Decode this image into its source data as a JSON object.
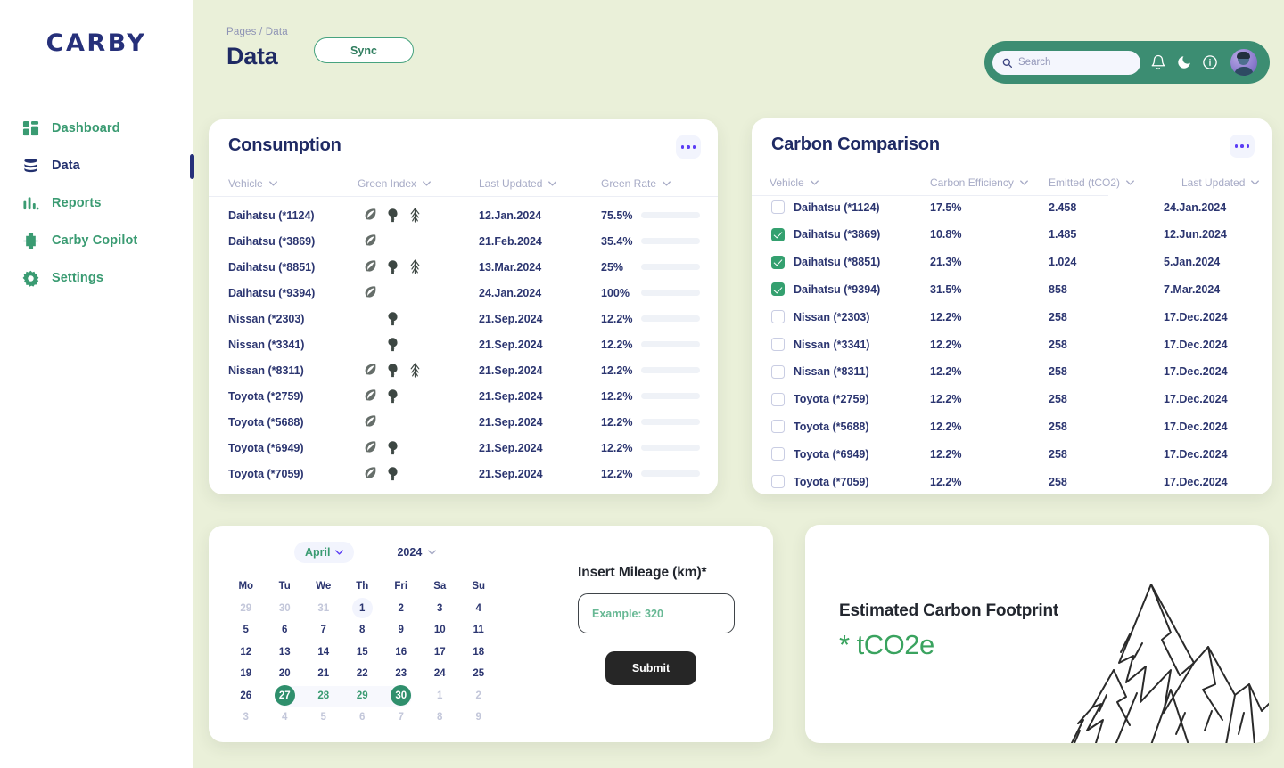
{
  "brand": {
    "logo": "CARBY"
  },
  "accent": {
    "green": "#3a9b72",
    "navy": "#22306e",
    "purple": "#5b3df5",
    "bar": "#2f8f6c",
    "page_bg": "#eaf0d9",
    "topbar": "#3c8d72"
  },
  "sidebar": {
    "items": [
      {
        "label": "Dashboard",
        "icon": "dashboard-icon",
        "active": false
      },
      {
        "label": "Data",
        "icon": "database-icon",
        "active": true
      },
      {
        "label": "Reports",
        "icon": "bar-chart-icon",
        "active": false
      },
      {
        "label": "Carby Copilot",
        "icon": "clover-icon",
        "active": false
      },
      {
        "label": "Settings",
        "icon": "gear-icon",
        "active": false
      }
    ]
  },
  "header": {
    "breadcrumb": "Pages / Data",
    "title": "Data",
    "sync_label": "Sync",
    "search_placeholder": "Search",
    "search_value": "",
    "icons": [
      "bell-icon",
      "moon-icon",
      "info-icon"
    ]
  },
  "consumption": {
    "title": "Consumption",
    "columns": [
      "Vehicle",
      "Green Index",
      "Last Updated",
      "Green Rate"
    ],
    "rows": [
      {
        "vehicle": "Daihatsu (*1124)",
        "index": [
          "leaf",
          "tree",
          "pine"
        ],
        "updated": "12.Jan.2024",
        "rate": "75.5%",
        "pct": 75.5
      },
      {
        "vehicle": "Daihatsu (*3869)",
        "index": [
          "leaf"
        ],
        "updated": "21.Feb.2024",
        "rate": "35.4%",
        "pct": 35.4
      },
      {
        "vehicle": "Daihatsu (*8851)",
        "index": [
          "leaf",
          "tree",
          "pine"
        ],
        "updated": "13.Mar.2024",
        "rate": "25%",
        "pct": 25
      },
      {
        "vehicle": "Daihatsu (*9394)",
        "index": [
          "leaf"
        ],
        "updated": "24.Jan.2024",
        "rate": "100%",
        "pct": 100
      },
      {
        "vehicle": "Nissan (*2303)",
        "index": [
          "tree"
        ],
        "updated": "21.Sep.2024",
        "rate": "12.2%",
        "pct": 12.2
      },
      {
        "vehicle": "Nissan (*3341)",
        "index": [
          "tree"
        ],
        "updated": "21.Sep.2024",
        "rate": "12.2%",
        "pct": 12.2
      },
      {
        "vehicle": "Nissan (*8311)",
        "index": [
          "leaf",
          "tree",
          "pine"
        ],
        "updated": "21.Sep.2024",
        "rate": "12.2%",
        "pct": 12.2
      },
      {
        "vehicle": "Toyota (*2759)",
        "index": [
          "leaf",
          "tree"
        ],
        "updated": "21.Sep.2024",
        "rate": "12.2%",
        "pct": 12.2
      },
      {
        "vehicle": "Toyota (*5688)",
        "index": [
          "leaf"
        ],
        "updated": "21.Sep.2024",
        "rate": "12.2%",
        "pct": 12.2
      },
      {
        "vehicle": "Toyota (*6949)",
        "index": [
          "leaf",
          "tree"
        ],
        "updated": "21.Sep.2024",
        "rate": "12.2%",
        "pct": 12.2
      },
      {
        "vehicle": "Toyota (*7059)",
        "index": [
          "leaf",
          "tree"
        ],
        "updated": "21.Sep.2024",
        "rate": "12.2%",
        "pct": 12.2
      }
    ]
  },
  "carbon": {
    "title": "Carbon Comparison",
    "columns": [
      "Vehicle",
      "Carbon Efficiency",
      "Emitted (tCO2)",
      "Last Updated"
    ],
    "rows": [
      {
        "checked": false,
        "vehicle": "Daihatsu (*1124)",
        "efficiency": "17.5%",
        "emitted": "2.458",
        "updated": "24.Jan.2024"
      },
      {
        "checked": true,
        "vehicle": "Daihatsu (*3869)",
        "efficiency": "10.8%",
        "emitted": "1.485",
        "updated": "12.Jun.2024"
      },
      {
        "checked": true,
        "vehicle": "Daihatsu (*8851)",
        "efficiency": "21.3%",
        "emitted": "1.024",
        "updated": "5.Jan.2024"
      },
      {
        "checked": true,
        "vehicle": "Daihatsu (*9394)",
        "efficiency": "31.5%",
        "emitted": "858",
        "updated": "7.Mar.2024"
      },
      {
        "checked": false,
        "vehicle": "Nissan (*2303)",
        "efficiency": "12.2%",
        "emitted": "258",
        "updated": "17.Dec.2024"
      },
      {
        "checked": false,
        "vehicle": "Nissan (*3341)",
        "efficiency": "12.2%",
        "emitted": "258",
        "updated": "17.Dec.2024"
      },
      {
        "checked": false,
        "vehicle": "Nissan (*8311)",
        "efficiency": "12.2%",
        "emitted": "258",
        "updated": "17.Dec.2024"
      },
      {
        "checked": false,
        "vehicle": "Toyota (*2759)",
        "efficiency": "12.2%",
        "emitted": "258",
        "updated": "17.Dec.2024"
      },
      {
        "checked": false,
        "vehicle": "Toyota (*5688)",
        "efficiency": "12.2%",
        "emitted": "258",
        "updated": "17.Dec.2024"
      },
      {
        "checked": false,
        "vehicle": "Toyota (*6949)",
        "efficiency": "12.2%",
        "emitted": "258",
        "updated": "17.Dec.2024"
      },
      {
        "checked": false,
        "vehicle": "Toyota (*7059)",
        "efficiency": "12.2%",
        "emitted": "258",
        "updated": "17.Dec.2024"
      }
    ]
  },
  "calendar": {
    "month": "April",
    "year": "2024",
    "dow": [
      "Mo",
      "Tu",
      "We",
      "Th",
      "Fri",
      "Sa",
      "Su"
    ],
    "weeks": [
      [
        {
          "d": "29",
          "s": "mut"
        },
        {
          "d": "30",
          "s": "mut"
        },
        {
          "d": "31",
          "s": "mut"
        },
        {
          "d": "1",
          "s": "today"
        },
        {
          "d": "2",
          "s": ""
        },
        {
          "d": "3",
          "s": ""
        },
        {
          "d": "4",
          "s": ""
        }
      ],
      [
        {
          "d": "5",
          "s": ""
        },
        {
          "d": "6",
          "s": ""
        },
        {
          "d": "7",
          "s": ""
        },
        {
          "d": "8",
          "s": ""
        },
        {
          "d": "9",
          "s": ""
        },
        {
          "d": "10",
          "s": ""
        },
        {
          "d": "11",
          "s": ""
        }
      ],
      [
        {
          "d": "12",
          "s": ""
        },
        {
          "d": "13",
          "s": ""
        },
        {
          "d": "14",
          "s": ""
        },
        {
          "d": "15",
          "s": ""
        },
        {
          "d": "16",
          "s": ""
        },
        {
          "d": "17",
          "s": ""
        },
        {
          "d": "18",
          "s": ""
        }
      ],
      [
        {
          "d": "19",
          "s": ""
        },
        {
          "d": "20",
          "s": ""
        },
        {
          "d": "21",
          "s": ""
        },
        {
          "d": "22",
          "s": ""
        },
        {
          "d": "23",
          "s": ""
        },
        {
          "d": "24",
          "s": ""
        },
        {
          "d": "25",
          "s": ""
        }
      ],
      [
        {
          "d": "26",
          "s": ""
        },
        {
          "d": "27",
          "s": "sel start"
        },
        {
          "d": "28",
          "s": "ingreen mid"
        },
        {
          "d": "29",
          "s": "ingreen mid"
        },
        {
          "d": "30",
          "s": "sel end"
        },
        {
          "d": "1",
          "s": "mut"
        },
        {
          "d": "2",
          "s": "mut"
        }
      ],
      [
        {
          "d": "3",
          "s": "mut"
        },
        {
          "d": "4",
          "s": "mut"
        },
        {
          "d": "5",
          "s": "mut"
        },
        {
          "d": "6",
          "s": "mut"
        },
        {
          "d": "7",
          "s": "mut"
        },
        {
          "d": "8",
          "s": "mut"
        },
        {
          "d": "9",
          "s": "mut"
        }
      ]
    ]
  },
  "mileage": {
    "label": "Insert Mileage (km)*",
    "placeholder": "Example: 320",
    "value": "",
    "submit_label": "Submit"
  },
  "footprint": {
    "title": "Estimated Carbon Footprint",
    "value": "* tCO2e"
  }
}
